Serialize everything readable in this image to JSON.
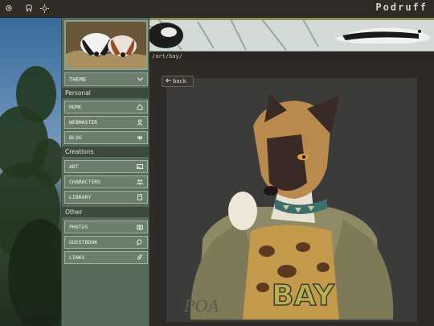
{
  "site": {
    "title": "Podruff"
  },
  "topbar": {
    "icons": [
      "settings-icon",
      "tooth-icon",
      "sun-icon"
    ]
  },
  "sidebar": {
    "theme_label": "THEME",
    "sections": [
      {
        "title": "Personal",
        "items": [
          {
            "label": "HOME",
            "icon": "home-icon"
          },
          {
            "label": "WEBMASTER",
            "icon": "user-icon"
          },
          {
            "label": "BLOG",
            "icon": "leaf-icon"
          }
        ]
      },
      {
        "title": "Creations",
        "items": [
          {
            "label": "ART",
            "icon": "image-icon"
          },
          {
            "label": "CHARACTERS",
            "icon": "group-icon"
          },
          {
            "label": "LIBRARY",
            "icon": "book-icon"
          }
        ]
      },
      {
        "title": "Other",
        "items": [
          {
            "label": "PHOTOS",
            "icon": "camera-icon"
          },
          {
            "label": "GUESTBOOK",
            "icon": "speech-bubble-icon"
          },
          {
            "label": "LINKS",
            "icon": "paperclip-icon"
          }
        ]
      }
    ]
  },
  "path": "/art/bay/",
  "main": {
    "back_label": "back",
    "art_text": "BAY",
    "signature": "POA"
  },
  "colors": {
    "sidebar": "#576b5a",
    "button": "#6a7e6b",
    "page": "#2e2a26"
  }
}
